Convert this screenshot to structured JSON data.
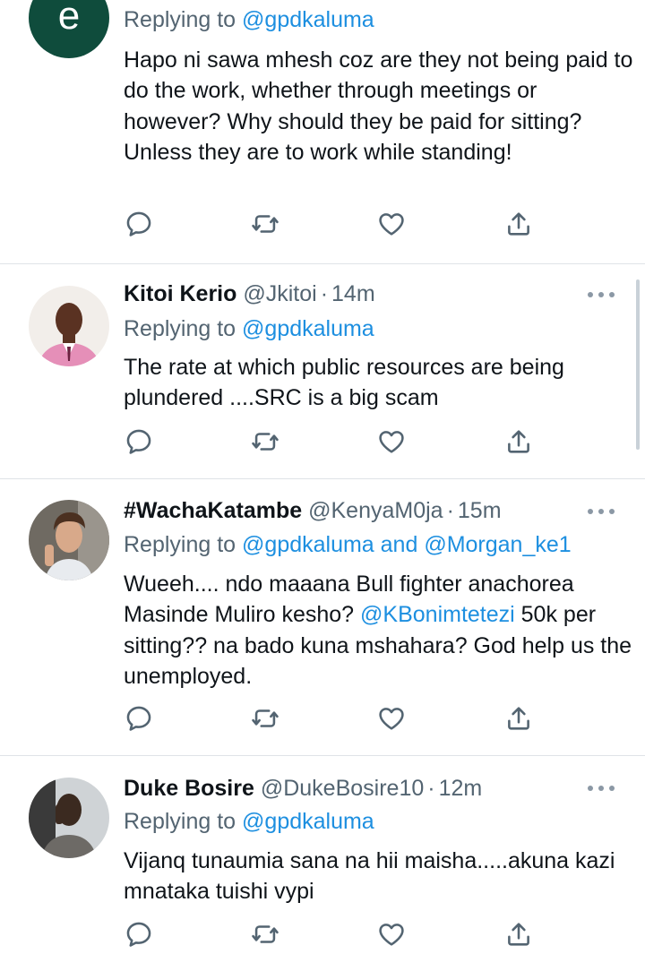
{
  "tweets": [
    {
      "avatar_letter": "e",
      "avatar_color": "#0f4c3c",
      "reply_prefix": "Replying to",
      "reply_to": "@gpdkaluma",
      "text": "Hapo ni sawa mhesh coz are they not being paid to do the work, whether through meetings or however? Why should they be paid for sitting? Unless they are to work while standing!"
    },
    {
      "name": "Kitoi Kerio",
      "handle": "@Jkitoi",
      "separator": "·",
      "time": "14m",
      "reply_prefix": "Replying to",
      "reply_to": "@gpdkaluma",
      "text": "The rate at which public resources are being plundered ....SRC is a big scam"
    },
    {
      "name": "#WachaKatambe",
      "handle": "@KenyaM0ja",
      "separator": "·",
      "time": "15m",
      "reply_prefix": "Replying to",
      "reply_to": "@gpdkaluma and @Morgan_ke1",
      "text_before_mention": "Wueeh.... ndo maaana Bull fighter anachorea Masinde Muliro kesho?",
      "mention": "@KBonimtetezi",
      "text_after_mention": "50k per sitting??  na bado kuna mshahara? God help us the unemployed."
    },
    {
      "name": "Duke Bosire",
      "handle": "@DukeBosire10",
      "separator": "·",
      "time": "12m",
      "reply_prefix": "Replying to",
      "reply_to": "@gpdkaluma",
      "text": "Vijanq tunaumia sana na hii maisha.....akuna kazi mnataka tuishi vypi"
    }
  ],
  "icons": {
    "reply": "comment-icon",
    "retweet": "retweet-icon",
    "like": "heart-icon",
    "share": "share-icon",
    "more": "more-options-icon"
  },
  "colors": {
    "link": "#1d8fe0",
    "secondary_text": "#536471",
    "icon": "#536471",
    "divider": "#dfe3e7"
  }
}
